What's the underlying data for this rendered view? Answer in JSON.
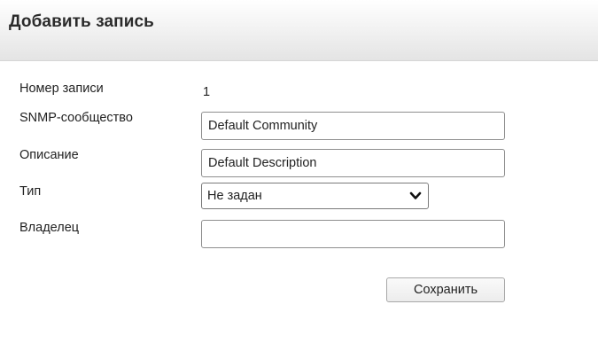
{
  "header": {
    "title": "Добавить запись"
  },
  "form": {
    "record_number": {
      "label": "Номер записи",
      "value": "1"
    },
    "community": {
      "label": "SNMP-сообщество",
      "value": "Default Community",
      "placeholder": ""
    },
    "description": {
      "label": "Описание",
      "value": "Default Description",
      "placeholder": ""
    },
    "type": {
      "label": "Тип",
      "selected": "Не задан",
      "icon": "chevron-down-icon"
    },
    "owner": {
      "label": "Владелец",
      "value": "",
      "placeholder": ""
    },
    "save_label": "Сохранить"
  },
  "colors": {
    "header_gradient_end": "#e4e4e4",
    "input_border": "#8f8f8f",
    "text": "#222222"
  }
}
